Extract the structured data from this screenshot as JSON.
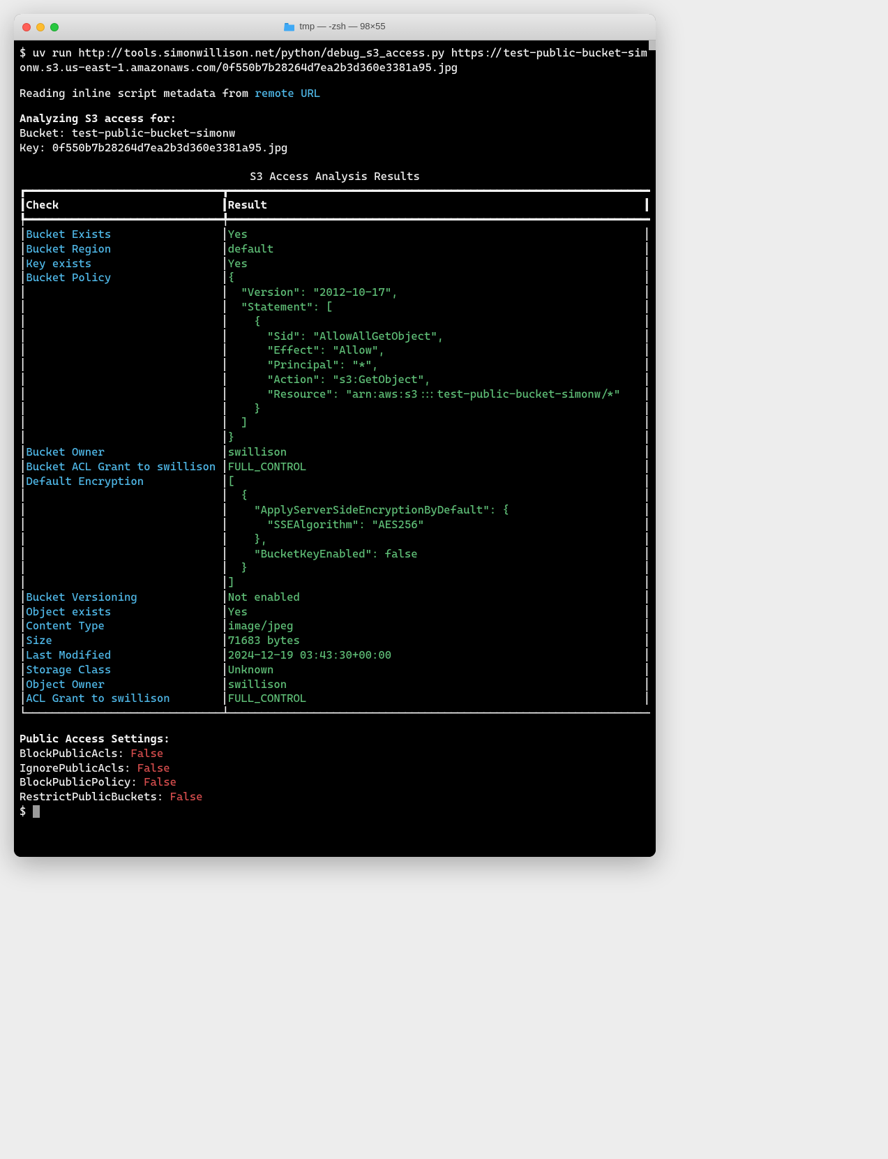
{
  "window": {
    "title": "tmp — -zsh — 98×55"
  },
  "session": {
    "prompt1": "$ ",
    "command": "uv run http://tools.simonwillison.net/python/debug_s3_access.py https://test-public-bucket-simonw.s3.us-east-1.amazonaws.com/0f550b7b28264d7ea2b3d360e3381a95.jpg",
    "reading_prefix": "Reading inline script metadata from ",
    "reading_link": "remote URL",
    "analyzing_header": "Analyzing S3 access for:",
    "bucket_label": "Bucket: ",
    "bucket_value": "test-public-bucket-simonw",
    "key_label": "Key: ",
    "key_value": "0f550b7b28264d7ea2b3d360e3381a95.jpg",
    "prompt2": "$ "
  },
  "table": {
    "title": "S3 Access Analysis Results",
    "col1_header": "Check",
    "col2_header": "Result",
    "rows": [
      {
        "check": "Bucket Exists",
        "result": "Yes"
      },
      {
        "check": "Bucket Region",
        "result": "default"
      },
      {
        "check": "Key exists",
        "result": "Yes"
      },
      {
        "check": "Bucket Policy",
        "result": "{"
      },
      {
        "check": "",
        "result": "  \"Version\": \"2012-10-17\","
      },
      {
        "check": "",
        "result": "  \"Statement\": ["
      },
      {
        "check": "",
        "result": "    {"
      },
      {
        "check": "",
        "result": "      \"Sid\": \"AllowAllGetObject\","
      },
      {
        "check": "",
        "result": "      \"Effect\": \"Allow\","
      },
      {
        "check": "",
        "result": "      \"Principal\": \"*\","
      },
      {
        "check": "",
        "result": "      \"Action\": \"s3:GetObject\","
      },
      {
        "check": "",
        "result": "      \"Resource\": \"arn:aws:s3:::test-public-bucket-simonw/*\""
      },
      {
        "check": "",
        "result": "    }"
      },
      {
        "check": "",
        "result": "  ]"
      },
      {
        "check": "",
        "result": "}"
      },
      {
        "check": "Bucket Owner",
        "result": "swillison"
      },
      {
        "check": "Bucket ACL Grant to swillison",
        "result": "FULL_CONTROL"
      },
      {
        "check": "Default Encryption",
        "result": "["
      },
      {
        "check": "",
        "result": "  {"
      },
      {
        "check": "",
        "result": "    \"ApplyServerSideEncryptionByDefault\": {"
      },
      {
        "check": "",
        "result": "      \"SSEAlgorithm\": \"AES256\""
      },
      {
        "check": "",
        "result": "    },"
      },
      {
        "check": "",
        "result": "    \"BucketKeyEnabled\": false"
      },
      {
        "check": "",
        "result": "  }"
      },
      {
        "check": "",
        "result": "]"
      },
      {
        "check": "Bucket Versioning",
        "result": "Not enabled"
      },
      {
        "check": "Object exists",
        "result": "Yes"
      },
      {
        "check": "Content Type",
        "result": "image/jpeg"
      },
      {
        "check": "Size",
        "result": "71683 bytes"
      },
      {
        "check": "Last Modified",
        "result": "2024-12-19 03:43:30+00:00"
      },
      {
        "check": "Storage Class",
        "result": "Unknown"
      },
      {
        "check": "Object Owner",
        "result": "swillison"
      },
      {
        "check": "ACL Grant to swillison",
        "result": "FULL_CONTROL"
      }
    ]
  },
  "public_access": {
    "header": "Public Access Settings:",
    "items": [
      {
        "label": "BlockPublicAcls: ",
        "value": "False"
      },
      {
        "label": "IgnorePublicAcls: ",
        "value": "False"
      },
      {
        "label": "BlockPublicPolicy: ",
        "value": "False"
      },
      {
        "label": "RestrictPublicBuckets: ",
        "value": "False"
      }
    ]
  },
  "colors": {
    "cyan": "#4fb8e8",
    "green": "#5fbf77",
    "red": "#d64d4d",
    "white": "#f2f2f2",
    "bg": "#000000"
  }
}
